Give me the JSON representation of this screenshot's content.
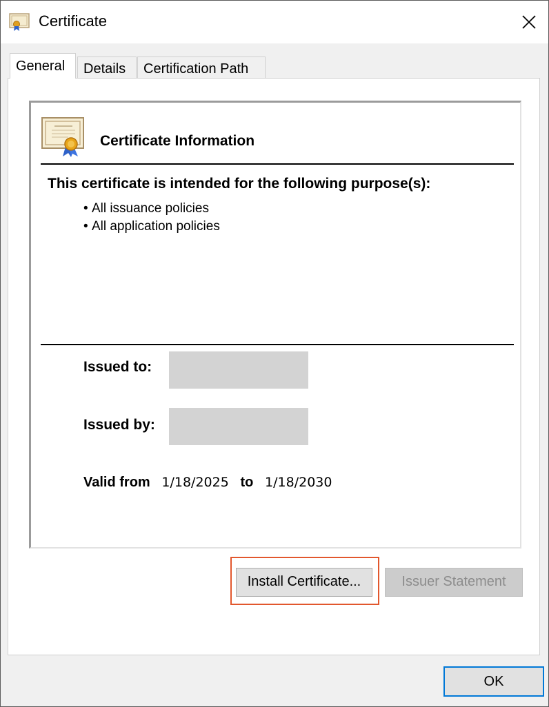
{
  "window": {
    "title": "Certificate",
    "icon": "certificate-icon"
  },
  "tabs": [
    {
      "label": "General",
      "active": true
    },
    {
      "label": "Details",
      "active": false
    },
    {
      "label": "Certification Path",
      "active": false
    }
  ],
  "info": {
    "title": "Certificate Information",
    "purpose_heading": "This certificate is intended for the following purpose(s):",
    "purposes": [
      "All issuance policies",
      "All application policies"
    ],
    "issued_to_label": "Issued to:",
    "issued_by_label": "Issued by:",
    "valid_from_label": "Valid from",
    "valid_from": "1/18/2025",
    "to_label": "to",
    "valid_to": "1/18/2030"
  },
  "buttons": {
    "install": "Install Certificate...",
    "issuer_statement": "Issuer Statement",
    "ok": "OK"
  },
  "colors": {
    "highlight": "#e2572d",
    "focus": "#0078d7",
    "redaction": "#d3d3d3"
  }
}
